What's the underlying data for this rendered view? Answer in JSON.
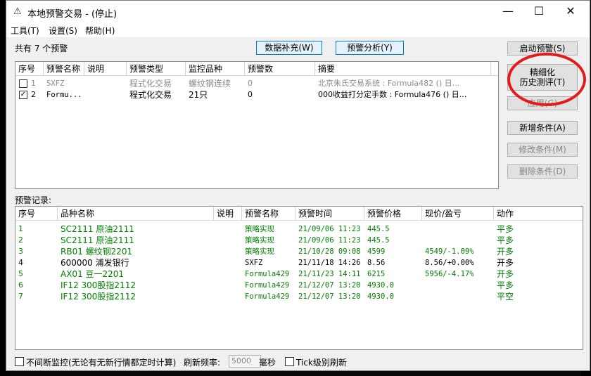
{
  "window": {
    "icon": "warning-triangle-icon",
    "title": "本地预警交易 - (停止)",
    "minimize": "—",
    "maximize": "☐",
    "close": "✕"
  },
  "menu": [
    "工具(T)",
    "设置(S)",
    "帮助(H)"
  ],
  "summary": "共有 7 个预警",
  "buttons": {
    "data_fill": "数据补充(W)",
    "analysis": "预警分析(Y)",
    "start": "启动预警(S)",
    "backtest_line1": "精细化",
    "backtest_line2": "历史测评(T)",
    "apply": "应用(G)",
    "add": "新增条件(A)",
    "edit": "修改条件(M)",
    "delete": "删除条件(D)"
  },
  "alerts": {
    "headers": [
      "序号",
      "预警名称",
      "说明",
      "预警类型",
      "监控品种",
      "预警数",
      "摘要"
    ],
    "rows": [
      {
        "checked": false,
        "no": "1",
        "name": "SXFZ",
        "desc": "",
        "type": "程式化交易",
        "symbol": "螺纹钢连续",
        "count": "0",
        "summary": "北京朱氏交易系统 : Formula482 () 日...",
        "disabled": true
      },
      {
        "checked": true,
        "no": "2",
        "name": "Formu...",
        "desc": "",
        "type": "程式化交易",
        "symbol": "21只",
        "count": "0",
        "summary": "000收益打分定手数 : Formula476 () 日...",
        "disabled": false
      }
    ]
  },
  "records_label": "预警记录:",
  "records": {
    "headers": [
      "序号",
      "品种名称",
      "说明",
      "预警名称",
      "预警时间",
      "预警价格",
      "现价/盈亏",
      "动作"
    ],
    "rows": [
      {
        "no": "1",
        "symbol": "SC2111 原油2111",
        "desc": "",
        "alert": "策略实现",
        "time": "21/09/06 11:23",
        "price": "445.5",
        "pnl": "",
        "action": "平多",
        "color": "green"
      },
      {
        "no": "2",
        "symbol": "SC2111 原油2111",
        "desc": "",
        "alert": "策略实现",
        "time": "21/09/06 11:23",
        "price": "445.5",
        "pnl": "",
        "action": "平多",
        "color": "green"
      },
      {
        "no": "3",
        "symbol": "RB01 螺纹钢2201",
        "desc": "",
        "alert": "策略实现",
        "time": "21/10/28 09:08",
        "price": "4599",
        "pnl": "4549/-1.09%",
        "action": "开多",
        "color": "green"
      },
      {
        "no": "4",
        "symbol": "600000 浦发银行",
        "desc": "",
        "alert": "SXFZ",
        "time": "21/11/18 14:26",
        "price": "8.56",
        "pnl": "8.56/+0.00%",
        "action": "开多",
        "color": "black"
      },
      {
        "no": "5",
        "symbol": "AX01 豆一2201",
        "desc": "",
        "alert": "Formula429",
        "time": "21/11/23 14:11",
        "price": "6215",
        "pnl": "5956/-4.17%",
        "action": "开多",
        "color": "green"
      },
      {
        "no": "6",
        "symbol": "IF12 300股指2112",
        "desc": "",
        "alert": "Formula429",
        "time": "21/12/07 13:20",
        "price": "4930.0",
        "pnl": "",
        "action": "平多",
        "color": "green"
      },
      {
        "no": "7",
        "symbol": "IF12 300股指2112",
        "desc": "",
        "alert": "Formula429",
        "time": "21/12/07 13:20",
        "price": "4930.0",
        "pnl": "",
        "action": "平空",
        "color": "green"
      }
    ]
  },
  "footer": {
    "continuous_label": "不间断监控(无论有无新行情都定时计算)",
    "refresh_label": "刷新频率:",
    "refresh_value": "5000",
    "unit": "毫秒",
    "tick_label": "Tick级别刷新"
  },
  "colors": {
    "highlight": "#e31b1b",
    "green": "#008000",
    "accent": "#0078d7"
  }
}
